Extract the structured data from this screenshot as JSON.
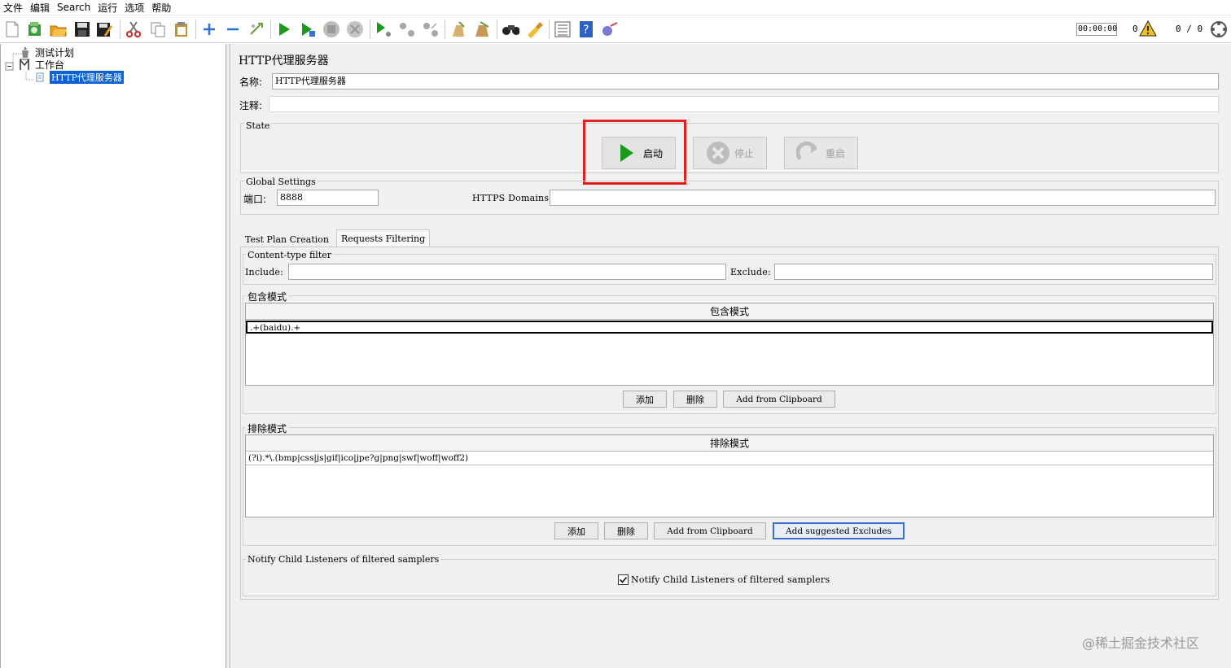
{
  "menu": [
    "文件",
    "编辑",
    "Search",
    "运行",
    "选项",
    "帮助"
  ],
  "toolbar": {
    "timer": "00:00:00",
    "warnings": "0",
    "counter": "0 / 0"
  },
  "tree": {
    "items": [
      {
        "label": "测试计划"
      },
      {
        "label": "工作台"
      },
      {
        "label": "HTTP代理服务器"
      }
    ]
  },
  "panel": {
    "title": "HTTP代理服务器",
    "name_label": "名称:",
    "name_value": "HTTP代理服务器",
    "comment_label": "注释:",
    "comment_value": "",
    "state_title": "State",
    "start_label": "启动",
    "stop_label": "停止",
    "restart_label": "重启",
    "global_title": "Global Settings",
    "port_label": "端口:",
    "port_value": "8888",
    "https_label": "HTTPS Domains :",
    "https_value": ""
  },
  "tabs": [
    "Test Plan Creation",
    "Requests Filtering"
  ],
  "filter": {
    "content_type_title": "Content-type filter",
    "include_label": "Include:",
    "include_value": "",
    "exclude_label": "Exclude:",
    "exclude_value": ""
  },
  "include_patterns": {
    "title": "包含模式",
    "header": "包含模式",
    "rows": [
      ".+(baidu).+"
    ],
    "add": "添加",
    "delete": "删除",
    "clipboard": "Add from Clipboard"
  },
  "exclude_patterns": {
    "title": "排除模式",
    "header": "排除模式",
    "rows": [
      "(?i).*\\.(bmp|css|js|gif|ico|jpe?g|png|swf|woff|woff2)"
    ],
    "add": "添加",
    "delete": "删除",
    "clipboard": "Add from Clipboard",
    "suggested": "Add suggested Excludes"
  },
  "notify": {
    "title": "Notify Child Listeners of filtered samplers",
    "checkbox_label": "Notify Child Listeners of filtered samplers",
    "checked": true
  },
  "watermark": "@稀土掘金技术社区",
  "colors": {
    "selection": "#0a63d6",
    "highlight_box": "#e02020",
    "start_green": "#1a9a1a"
  }
}
